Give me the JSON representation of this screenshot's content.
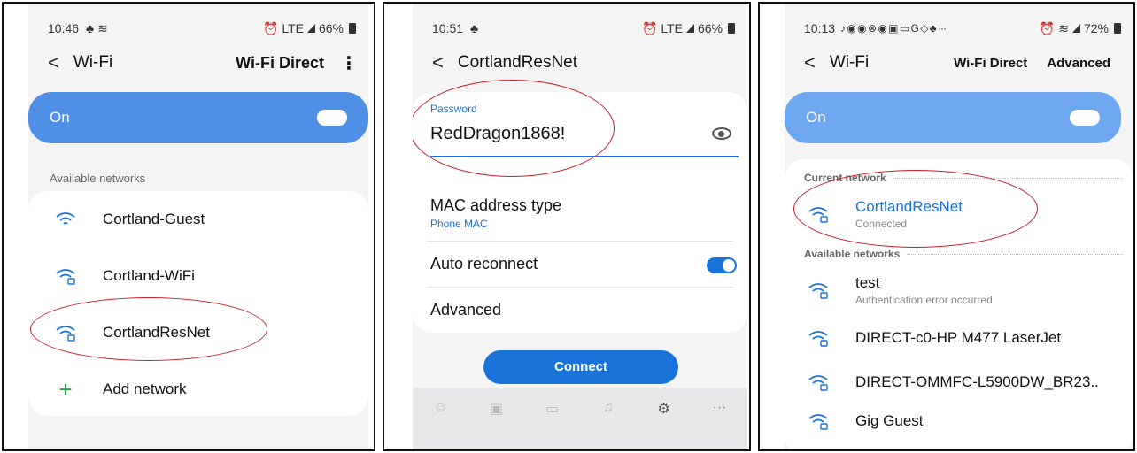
{
  "panel1": {
    "status": {
      "time": "10:46",
      "left_icons": "♣ ≋",
      "right_icons": "⏰ LTE",
      "battery": "66%"
    },
    "title": "Wi-Fi",
    "action": "Wi-Fi Direct",
    "more": "⋮",
    "toggle_label": "On",
    "section_label": "Available networks",
    "networks": [
      {
        "name": "Cortland-Guest",
        "icon": "wifi-icon"
      },
      {
        "name": "Cortland-WiFi",
        "icon": "wifi-lock-icon"
      },
      {
        "name": "CortlandResNet",
        "icon": "wifi-lock-icon"
      }
    ],
    "add_label": "Add network"
  },
  "panel2": {
    "status": {
      "time": "10:51",
      "left_icons": "♣",
      "right_icons": "⏰ LTE",
      "battery": "66%"
    },
    "title": "CortlandResNet",
    "password_label": "Password",
    "password_value": "RedDragon1868!",
    "mac_label": "MAC address type",
    "mac_value": "Phone MAC",
    "auto_label": "Auto reconnect",
    "advanced_label": "Advanced",
    "connect_label": "Connect"
  },
  "panel3": {
    "status": {
      "time": "10:13",
      "left_icons": "♪ ◉ ◉ ⊗ ◉ ▣ ▭ G ◇ ♣ ···",
      "right_icons": "⏰ ≋",
      "battery": "72%"
    },
    "title": "Wi-Fi",
    "action1": "Wi-Fi Direct",
    "action2": "Advanced",
    "toggle_label": "On",
    "current_label": "Current network",
    "current_network": {
      "name": "CortlandResNet",
      "status": "Connected"
    },
    "available_label": "Available networks",
    "networks": [
      {
        "name": "test",
        "status": "Authentication error occurred"
      },
      {
        "name": "DIRECT-c0-HP M477 LaserJet",
        "status": ""
      },
      {
        "name": "DIRECT-OMMFC-L5900DW_BR23..",
        "status": ""
      },
      {
        "name": "Gig Guest",
        "status": ""
      }
    ]
  },
  "colors": {
    "accent": "#1a73d9",
    "toggle_blue": "#4f8fe6",
    "toggle_blue_light": "#6fa6f0",
    "annotation_red": "#c81e28"
  }
}
